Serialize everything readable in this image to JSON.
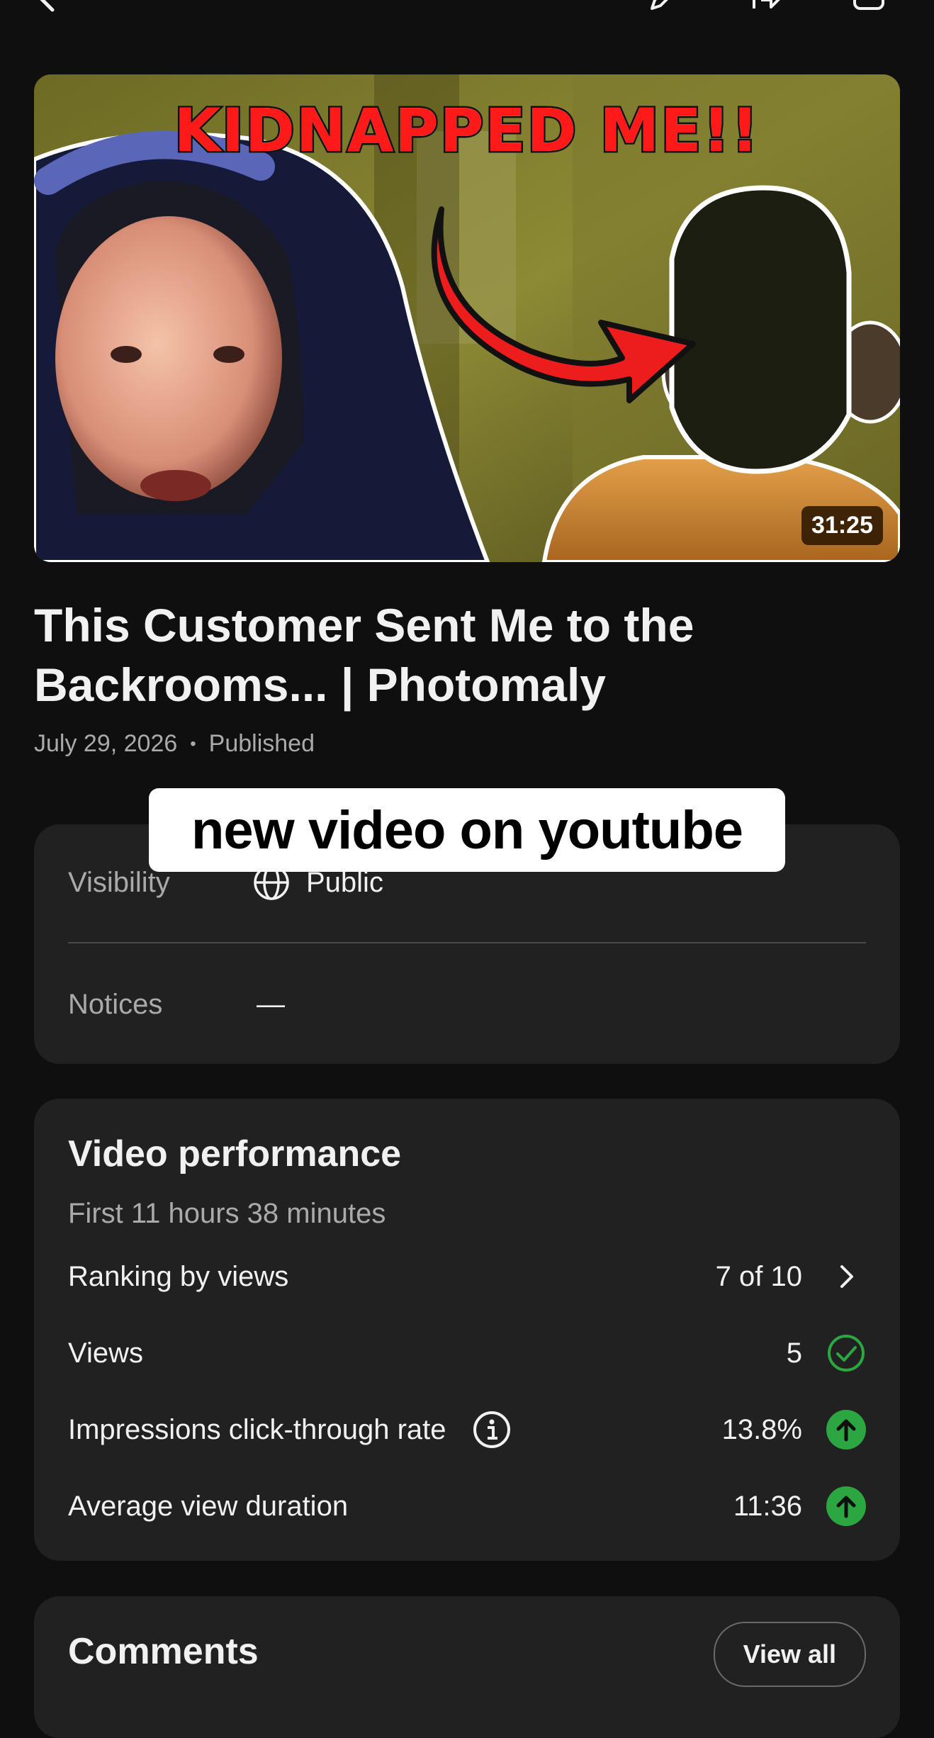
{
  "thumbnail": {
    "headline": "KIDNAPPED ME!!",
    "duration": "31:25"
  },
  "video": {
    "title": "This Customer Sent Me to the Backrooms... | Photomaly",
    "date": "July 29, 2026",
    "separator": "•",
    "status": "Published"
  },
  "overlay": {
    "caption": "new video on youtube"
  },
  "details": {
    "visibility_label": "Visibility",
    "visibility_value": "Public",
    "notices_label": "Notices",
    "notices_value": "—"
  },
  "performance": {
    "title": "Video performance",
    "subtitle": "First 11 hours 38 minutes",
    "rows": [
      {
        "label": "Ranking by views",
        "value": "7 of 10",
        "icon": "chevron-right-icon"
      },
      {
        "label": "Views",
        "value": "5",
        "icon": "check-circle-icon"
      },
      {
        "label": "Impressions click-through rate",
        "value": "13.8%",
        "icon": "arrow-up-circle-icon",
        "info_icon": "info-icon"
      },
      {
        "label": "Average view duration",
        "value": "11:36",
        "icon": "arrow-up-circle-icon"
      }
    ]
  },
  "comments": {
    "title": "Comments",
    "view_all": "View all"
  },
  "colors": {
    "background": "#0f0f0f",
    "card": "#212121",
    "positive_green": "#2ba640",
    "muted_text": "#aaaaaa"
  }
}
